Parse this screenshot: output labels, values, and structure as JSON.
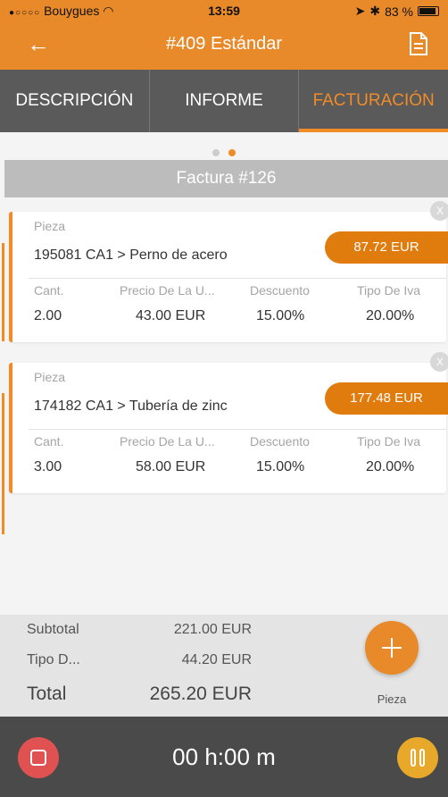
{
  "status_bar": {
    "carrier": "Bouygues",
    "time": "13:59",
    "battery": "83 %"
  },
  "nav": {
    "title": "#409 Estándar",
    "back_icon": "arrow-left-icon",
    "action_icon": "document-icon"
  },
  "tabs": [
    {
      "label": "DESCRIPCIÓN",
      "active": false
    },
    {
      "label": "INFORME",
      "active": false
    },
    {
      "label": "FACTURACIÓN",
      "active": true
    }
  ],
  "pager": {
    "pages": 2,
    "current": 2
  },
  "invoice": {
    "title": "Factura #126"
  },
  "items": [
    {
      "piece_label": "Pieza",
      "piece": "195081  CA1 > Perno de acero",
      "price": "87.72 EUR",
      "columns": [
        "Cant.",
        "Precio De La U...",
        "Descuento",
        "Tipo De Iva"
      ],
      "values": [
        "2.00",
        "43.00 EUR",
        "15.00%",
        "20.00%"
      ],
      "close": "X"
    },
    {
      "piece_label": "Pieza",
      "piece": "174182  CA1 > Tubería de zinc",
      "price": "177.48 EUR",
      "columns": [
        "Cant.",
        "Precio De La U...",
        "Descuento",
        "Tipo De Iva"
      ],
      "values": [
        "3.00",
        "58.00 EUR",
        "15.00%",
        "20.00%"
      ],
      "close": "X"
    }
  ],
  "summary": {
    "subtotal_label": "Subtotal",
    "subtotal": "221.00 EUR",
    "tax_label": "Tipo D...",
    "tax": "44.20 EUR",
    "total_label": "Total",
    "total": "265.20 EUR"
  },
  "fab": {
    "label": "Pieza"
  },
  "timer": {
    "value": "00 h:00 m"
  },
  "colors": {
    "accent": "#e8892a",
    "tabbar": "#5a5a5a",
    "bottombar": "#4a4a4a",
    "stop": "#e05252"
  }
}
